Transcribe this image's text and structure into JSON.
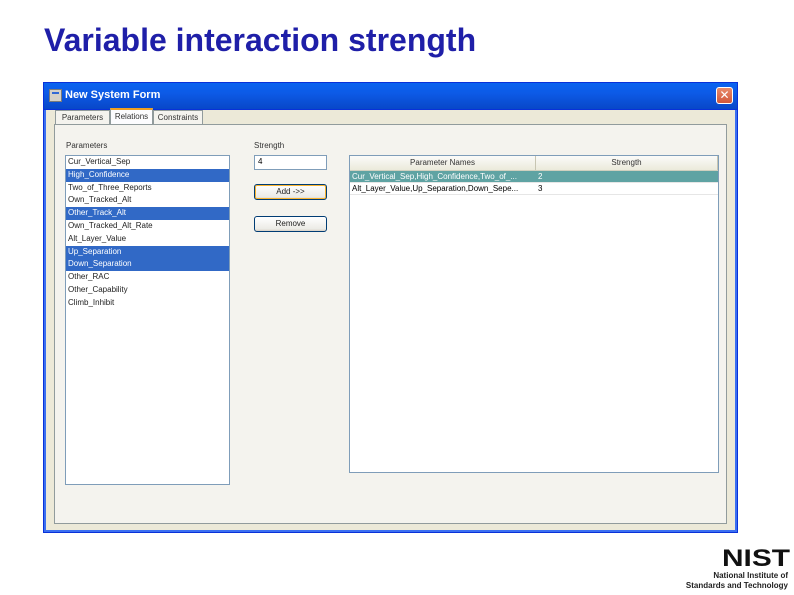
{
  "slide": {
    "title": "Variable interaction strength"
  },
  "window": {
    "title": "New System Form",
    "close_glyph": "✕",
    "tabs": [
      {
        "label": "Parameters",
        "active": false
      },
      {
        "label": "Relations",
        "active": true
      },
      {
        "label": "Constraints",
        "active": false
      }
    ]
  },
  "relations": {
    "parameters_label": "Parameters",
    "parameters": [
      {
        "label": "Cur_Vertical_Sep",
        "selected": false
      },
      {
        "label": "High_Confidence",
        "selected": true
      },
      {
        "label": "Two_of_Three_Reports",
        "selected": false
      },
      {
        "label": "Own_Tracked_Alt",
        "selected": false
      },
      {
        "label": "Other_Track_Alt",
        "selected": true
      },
      {
        "label": "Own_Tracked_Alt_Rate",
        "selected": false
      },
      {
        "label": "Alt_Layer_Value",
        "selected": false
      },
      {
        "label": "Up_Separation",
        "selected": true
      },
      {
        "label": "Down_Separation",
        "selected": true
      },
      {
        "label": "Other_RAC",
        "selected": false
      },
      {
        "label": "Other_Capability",
        "selected": false
      },
      {
        "label": "Climb_Inhibit",
        "selected": false
      }
    ],
    "strength_label": "Strength",
    "strength_value": "4",
    "add_button": "Add ->>",
    "remove_button": "Remove",
    "table": {
      "columns": [
        "Parameter Names",
        "Strength"
      ],
      "rows": [
        {
          "names": "Cur_Vertical_Sep,High_Confidence,Two_of_...",
          "strength": "2",
          "selected": true
        },
        {
          "names": "Alt_Layer_Value,Up_Separation,Down_Sepe...",
          "strength": "3",
          "selected": false
        }
      ]
    }
  },
  "branding": {
    "logo_text": "NIST",
    "line1": "National Institute of",
    "line2": "Standards and Technology"
  },
  "colors": {
    "title": "#1f1fa8",
    "selection": "#3169c6",
    "table_selection": "#5fa3a3"
  }
}
